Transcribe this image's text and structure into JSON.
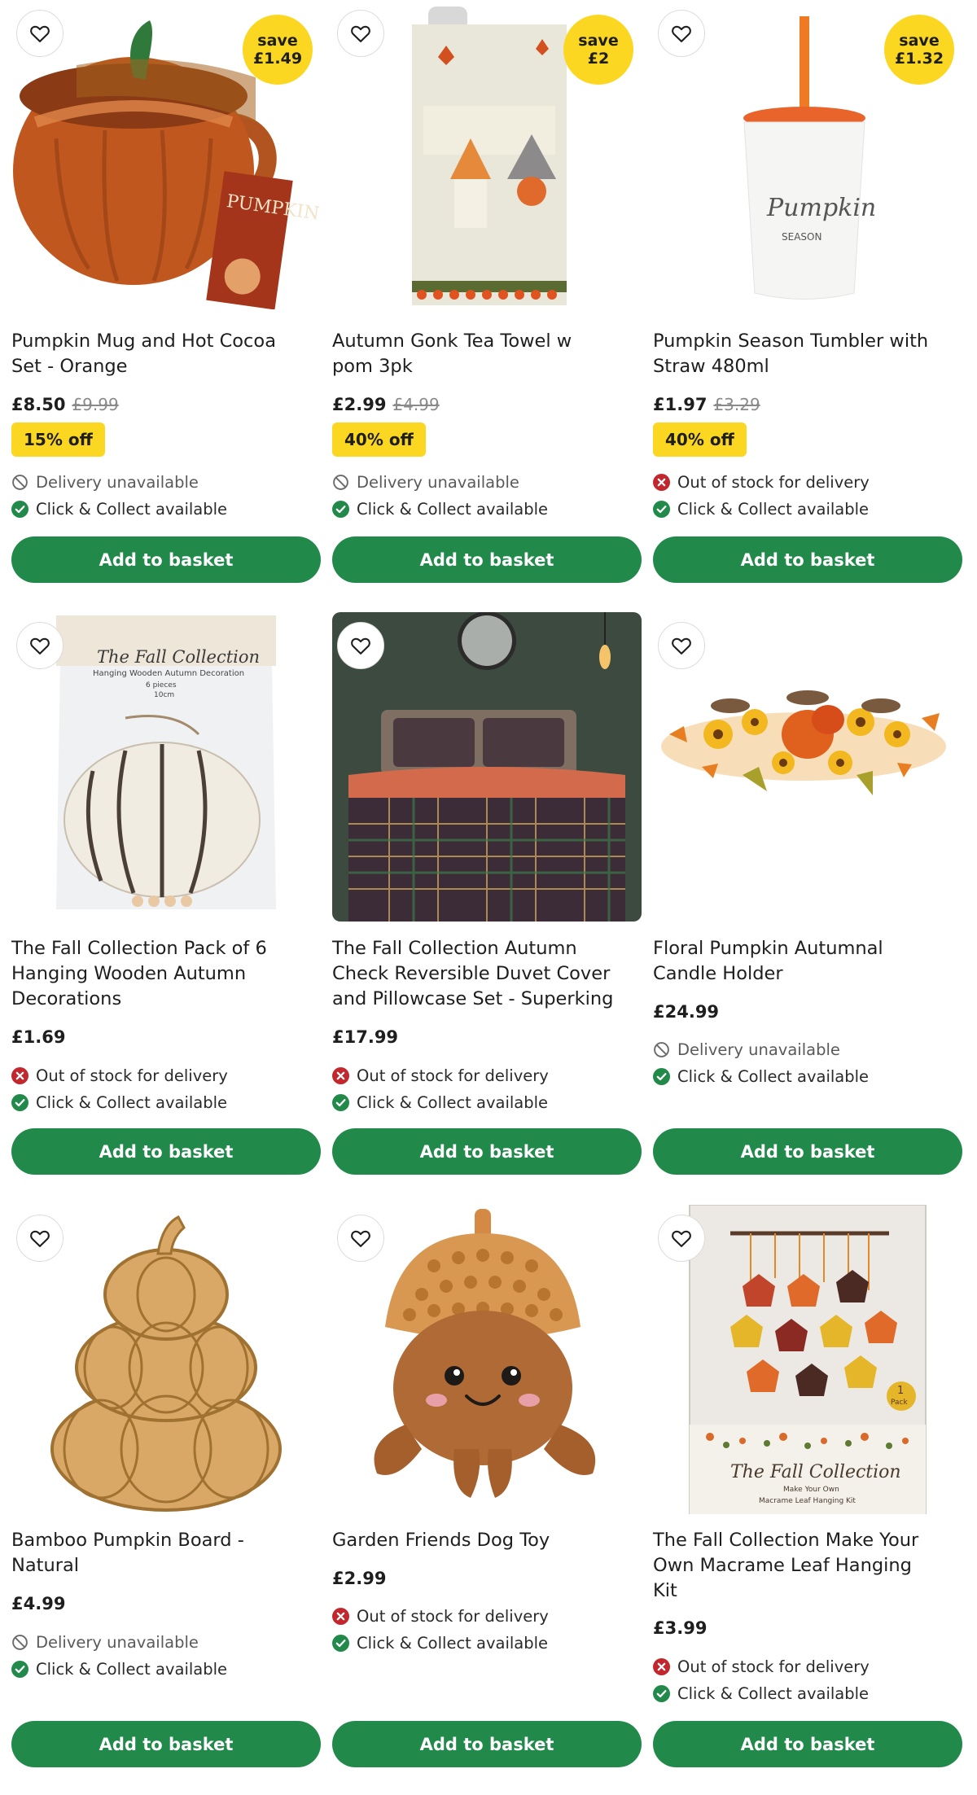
{
  "common": {
    "add_to_basket": "Add to basket",
    "delivery_unavailable": "Delivery unavailable",
    "out_of_stock": "Out of stock for delivery",
    "click_collect": "Click & Collect available"
  },
  "colors": {
    "brand_green": "#218a4a",
    "badge_yellow": "#fbd722",
    "error_red": "#c1272d"
  },
  "products": [
    {
      "title_line1": "Pumpkin Mug and Hot Cocoa",
      "title_line2": "Set - Orange",
      "price": "£8.50",
      "was_price": "£9.99",
      "save_line1": "save",
      "save_line2": "£1.49",
      "off_label": "15% off",
      "image_icon": "pumpkin-mug-icon"
    },
    {
      "title_line1": "Autumn Gonk Tea Towel w",
      "title_line2": "pom 3pk",
      "price": "£2.99",
      "was_price": "£4.99",
      "save_line1": "save",
      "save_line2": "£2",
      "off_label": "40% off",
      "image_icon": "tea-towel-icon"
    },
    {
      "title_line1": "Pumpkin Season Tumbler with",
      "title_line2": "Straw 480ml",
      "price": "£1.97",
      "was_price": "£3.29",
      "save_line1": "save",
      "save_line2": "£1.32",
      "off_label": "40% off",
      "image_icon": "tumbler-icon",
      "tumbler_text_1": "Pumpkin",
      "tumbler_text_2": "SEASON"
    },
    {
      "title_line1": "The Fall Collection Pack of 6",
      "title_line2": "Hanging Wooden Autumn",
      "title_line3": "Decorations",
      "price": "£1.69",
      "image_icon": "wooden-decorations-icon",
      "pack_title": "The Fall Collection",
      "pack_sub": "Hanging Wooden Autumn Decoration",
      "pack_pieces": "6 pieces",
      "pack_size": "10cm"
    },
    {
      "title_line1": "The Fall Collection Autumn",
      "title_line2": "Check Reversible Duvet Cover",
      "title_line3": "and Pillowcase Set - Superking",
      "price": "£17.99",
      "image_icon": "duvet-bedroom-icon"
    },
    {
      "title_line1": "Floral Pumpkin Autumnal",
      "title_line2": "Candle Holder",
      "price": "£24.99",
      "image_icon": "candle-holder-icon"
    },
    {
      "title_line1": "Bamboo Pumpkin Board -",
      "title_line2": "Natural",
      "price": "£4.99",
      "image_icon": "bamboo-board-icon"
    },
    {
      "title_line1": "Garden Friends Dog Toy",
      "price": "£2.99",
      "image_icon": "acorn-toy-icon"
    },
    {
      "title_line1": "The Fall Collection Make Your",
      "title_line2": "Own Macrame Leaf Hanging",
      "title_line3": "Kit",
      "price": "£3.99",
      "image_icon": "macrame-kit-icon",
      "kit_title": "The Fall Collection",
      "kit_sub1": "Make Your Own",
      "kit_sub2": "Macrame Leaf Hanging Kit",
      "kit_pack_1": "1",
      "kit_pack_2": "Pack"
    }
  ]
}
